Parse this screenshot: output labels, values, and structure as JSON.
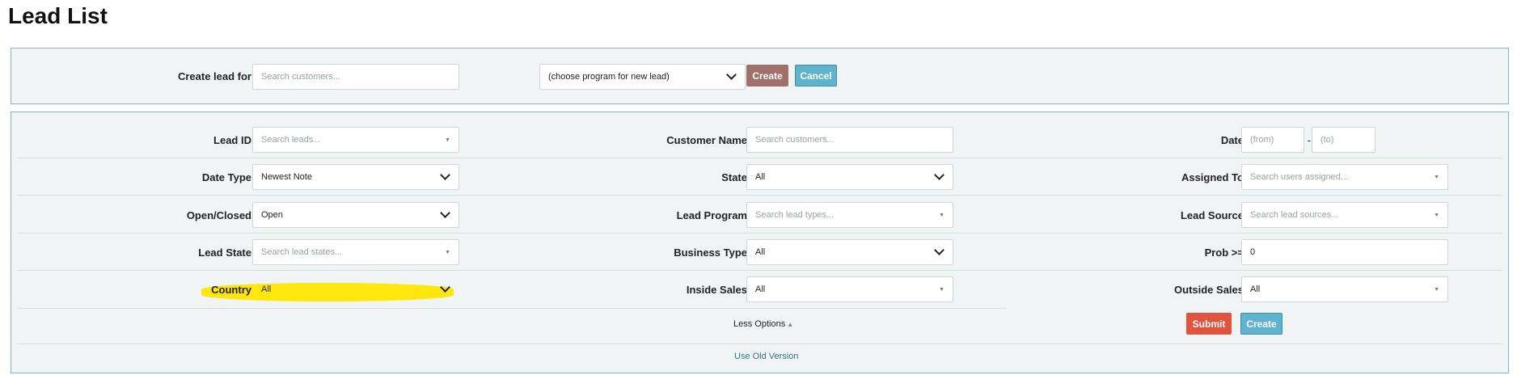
{
  "page": {
    "title": "Lead List"
  },
  "create_panel": {
    "label": "Create lead for",
    "customer_placeholder": "Search customers...",
    "program_select": "(choose program for new lead)",
    "create_label": "Create",
    "cancel_label": "Cancel"
  },
  "filters": {
    "lead_id": {
      "label": "Lead ID",
      "placeholder": "Search leads..."
    },
    "customer_name": {
      "label": "Customer Name",
      "placeholder": "Search customers..."
    },
    "date": {
      "label": "Date",
      "from_placeholder": "(from)",
      "separator": "-",
      "to_placeholder": "(to)"
    },
    "date_type": {
      "label": "Date Type",
      "value": "Newest Note"
    },
    "state": {
      "label": "State",
      "value": "All"
    },
    "assigned_to": {
      "label": "Assigned To",
      "placeholder": "Search users assigned..."
    },
    "open_closed": {
      "label": "Open/Closed",
      "value": "Open"
    },
    "lead_program": {
      "label": "Lead Program",
      "placeholder": "Search lead types..."
    },
    "lead_source": {
      "label": "Lead Source",
      "placeholder": "Search lead sources..."
    },
    "lead_state": {
      "label": "Lead State",
      "placeholder": "Search lead states..."
    },
    "business_type": {
      "label": "Business Type",
      "value": "All"
    },
    "prob": {
      "label": "Prob >=",
      "value": "0"
    },
    "country": {
      "label": "Country",
      "value": "All"
    },
    "inside_sales": {
      "label": "Inside Sales",
      "value": "All"
    },
    "outside_sales": {
      "label": "Outside Sales",
      "value": "All"
    }
  },
  "actions": {
    "less_options": "Less Options",
    "submit_label": "Submit",
    "create_label": "Create",
    "old_version": "Use Old Version"
  },
  "colors": {
    "create_button": "#a0706a",
    "cancel_button": "#5fb3cc",
    "submit_button": "#e0533d",
    "create_button_2": "#5fb3cc",
    "panel_border": "#7fb6c6",
    "highlight": "#ffe600"
  }
}
